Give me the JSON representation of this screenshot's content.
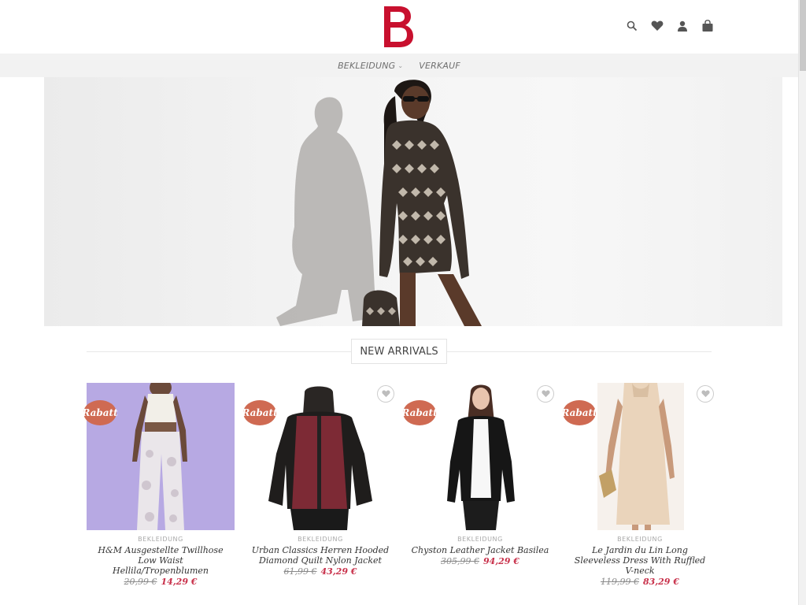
{
  "brand": {
    "logo_letter": "B",
    "color": "#c8102e"
  },
  "header_icons": [
    "search-icon",
    "heart-icon",
    "user-icon",
    "bag-icon"
  ],
  "nav": {
    "items": [
      {
        "label": "BEKLEIDUNG",
        "has_dropdown": true
      },
      {
        "label": "VERKAUF",
        "has_dropdown": false
      }
    ]
  },
  "section": {
    "title": "NEW ARRIVALS"
  },
  "colors": {
    "badge": "#cf6a52",
    "sale_price": "#c8304a"
  },
  "products": [
    {
      "badge": "Rabatt",
      "category": "BEKLEIDUNG",
      "name": "H&M Ausgestellte Twillhose Low Waist Hellila/Tropenblumen",
      "old_price": "20,99 €",
      "new_price": "14,29 €",
      "wishlist": false
    },
    {
      "badge": "Rabatt",
      "category": "BEKLEIDUNG",
      "name": "Urban Classics Herren Hooded Diamond Quilt Nylon Jacket",
      "old_price": "61,99 €",
      "new_price": "43,29 €",
      "wishlist": true
    },
    {
      "badge": "Rabatt",
      "category": "BEKLEIDUNG",
      "name": "Chyston Leather Jacket Basilea",
      "old_price": "305,99 €",
      "new_price": "94,29 €",
      "wishlist": true
    },
    {
      "badge": "Rabatt",
      "category": "BEKLEIDUNG",
      "name": "Le Jardin du Lin Long Sleeveless Dress With Ruffled V-neck",
      "old_price": "119,99 €",
      "new_price": "83,29 €",
      "wishlist": true
    }
  ]
}
